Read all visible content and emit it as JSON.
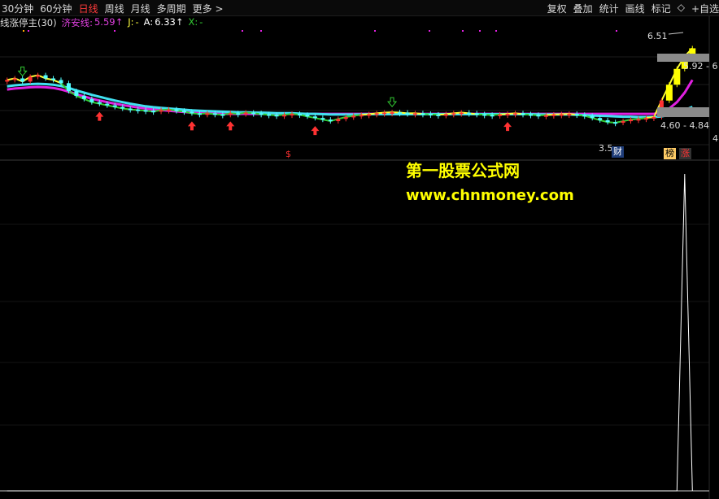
{
  "toolbar": {
    "left": [
      "30分钟",
      "60分钟",
      "日线",
      "周线",
      "月线",
      "多周期",
      "更多 >"
    ],
    "active": "日线",
    "right": [
      "复权",
      "叠加",
      "统计",
      "画线",
      "标记",
      "◇",
      "+自选"
    ]
  },
  "legend": {
    "name": "线涨停主(30)",
    "jian_label": "济安线:",
    "jian_value": "5.59↑",
    "j_label": "J:",
    "j_value": "-",
    "a_label": "A:",
    "a_value": "6.33↑",
    "x_label": "X:",
    "x_value": "-"
  },
  "price_labels": {
    "high": "6.51",
    "box_upper": "5.92 - 6",
    "box_lower": "4.60 - 4.84",
    "low": "3.5",
    "right_axis_tick": "4"
  },
  "markers": {
    "dollar": "$",
    "cai": "财",
    "bang": "榜",
    "zhang": "涨"
  },
  "watermark": {
    "line1": "第一股票公式网",
    "line2": "www.chnmoney.com"
  },
  "colors": {
    "up": "#ff3232",
    "down": "#54ffff",
    "ma_cyan": "#40e0f0",
    "ma_magenta": "#e020e0",
    "jian_green": "#33cc33",
    "jian_yellow": "#ffff33",
    "limit_up": "#ffff00",
    "background": "#000000"
  },
  "chart_data": {
    "type": "candlestick",
    "ylim": [
      3.2,
      7.1
    ],
    "closes": [
      5.55,
      5.6,
      5.5,
      5.65,
      5.7,
      5.6,
      5.55,
      5.45,
      5.2,
      5.05,
      4.95,
      4.85,
      4.8,
      4.75,
      4.7,
      4.65,
      4.62,
      4.6,
      4.58,
      4.55,
      4.6,
      4.62,
      4.58,
      4.55,
      4.5,
      4.48,
      4.5,
      4.47,
      4.45,
      4.5,
      4.48,
      4.52,
      4.5,
      4.47,
      4.45,
      4.43,
      4.45,
      4.48,
      4.45,
      4.4,
      4.35,
      4.3,
      4.25,
      4.32,
      4.38,
      4.42,
      4.45,
      4.47,
      4.5,
      4.52,
      4.53,
      4.52,
      4.5,
      4.5,
      4.48,
      4.46,
      4.45,
      4.47,
      4.5,
      4.52,
      4.5,
      4.47,
      4.45,
      4.44,
      4.46,
      4.48,
      4.5,
      4.47,
      4.45,
      4.43,
      4.44,
      4.46,
      4.47,
      4.48,
      4.45,
      4.42,
      4.35,
      4.28,
      4.22,
      4.2,
      4.25,
      4.3,
      4.32,
      4.35,
      4.38,
      4.9,
      5.4,
      5.9,
      6.3,
      6.55
    ],
    "cyan_ma": [
      5.35,
      5.38,
      5.4,
      5.42,
      5.43,
      5.42,
      5.4,
      5.36,
      5.3,
      5.22,
      5.15,
      5.08,
      5.02,
      4.96,
      4.9,
      4.85,
      4.8,
      4.76,
      4.72,
      4.69,
      4.67,
      4.65,
      4.63,
      4.61,
      4.59,
      4.58,
      4.57,
      4.56,
      4.55,
      4.54,
      4.53,
      4.53,
      4.52,
      4.52,
      4.51,
      4.5,
      4.5,
      4.5,
      4.49,
      4.48,
      4.48,
      4.47,
      4.46,
      4.46,
      4.46,
      4.46,
      4.46,
      4.47,
      4.47,
      4.47,
      4.47,
      4.47,
      4.47,
      4.47,
      4.47,
      4.47,
      4.47,
      4.47,
      4.47,
      4.47,
      4.47,
      4.47,
      4.47,
      4.47,
      4.47,
      4.47,
      4.47,
      4.47,
      4.47,
      4.46,
      4.46,
      4.46,
      4.46,
      4.46,
      4.45,
      4.44,
      4.43,
      4.42,
      4.41,
      4.4,
      4.39,
      4.39,
      4.38,
      4.38,
      4.38,
      4.4,
      4.45,
      4.52,
      4.6,
      4.7
    ],
    "magenta_ma": [
      5.25,
      5.28,
      5.3,
      5.32,
      5.33,
      5.32,
      5.3,
      5.25,
      5.18,
      5.1,
      5.03,
      4.96,
      4.9,
      4.85,
      4.8,
      4.76,
      4.72,
      4.68,
      4.65,
      4.62,
      4.6,
      4.58,
      4.56,
      4.54,
      4.52,
      4.51,
      4.5,
      4.49,
      4.48,
      4.48,
      4.48,
      4.48,
      4.48,
      4.48,
      4.48,
      4.48,
      4.48,
      4.48,
      4.48,
      4.48,
      4.48,
      4.48,
      4.48,
      4.48,
      4.48,
      4.48,
      4.48,
      4.48,
      4.48,
      4.48,
      4.48,
      4.48,
      4.48,
      4.48,
      4.48,
      4.48,
      4.48,
      4.48,
      4.48,
      4.48,
      4.48,
      4.48,
      4.48,
      4.48,
      4.48,
      4.48,
      4.48,
      4.48,
      4.48,
      4.48,
      4.48,
      4.48,
      4.48,
      4.48,
      4.48,
      4.48,
      4.48,
      4.48,
      4.48,
      4.48,
      4.48,
      4.48,
      4.48,
      4.48,
      4.48,
      4.52,
      4.65,
      4.85,
      5.15,
      5.55
    ],
    "indicator_spike": [
      0,
      0,
      0,
      0,
      0,
      0,
      0,
      0,
      0,
      0,
      0,
      0,
      0,
      0,
      0,
      0,
      0,
      0,
      0,
      0,
      0,
      0,
      0,
      0,
      0,
      0,
      0,
      0,
      0,
      0,
      0,
      0,
      0,
      0,
      0,
      0,
      0,
      0,
      0,
      0,
      0,
      0,
      0,
      0,
      0,
      0,
      0,
      0,
      0,
      0,
      0,
      0,
      0,
      0,
      0,
      0,
      0,
      0,
      0,
      0,
      0,
      0,
      0,
      0,
      0,
      0,
      0,
      0,
      0,
      0,
      0,
      0,
      0,
      0,
      0,
      0,
      0,
      0,
      0,
      0,
      0,
      0,
      0,
      0,
      0,
      0,
      0,
      0,
      1,
      0
    ],
    "indicator_ylim": [
      0,
      1
    ]
  }
}
